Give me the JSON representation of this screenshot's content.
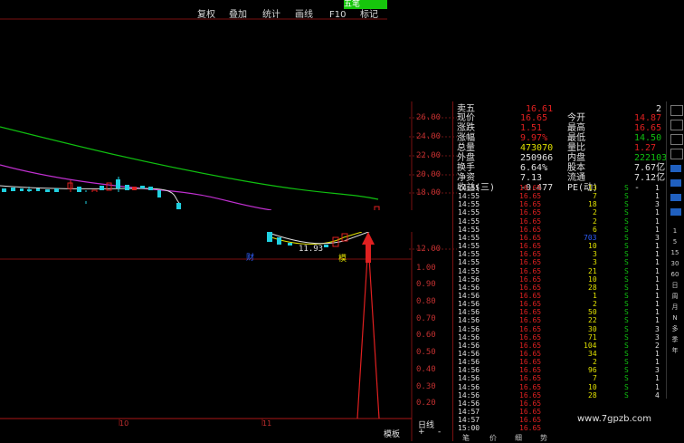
{
  "toolbar": {
    "btn1": "复权",
    "btn2": "叠加",
    "btn3": "统计",
    "btn4": "画线",
    "btn5": "F10",
    "btn6": "标记",
    "tag": "五笔"
  },
  "price_axis": [
    "26.00",
    "24.00",
    "22.00",
    "20.00",
    "18.00",
    "12.00"
  ],
  "vol_axis": [
    "1.00",
    "0.90",
    "0.80",
    "0.70",
    "0.60",
    "0.50",
    "0.40",
    "0.30",
    "0.20"
  ],
  "chart_labels": {
    "low_price": "11.93",
    "cai": "财",
    "mo": "模"
  },
  "bottom": {
    "mode": "模板",
    "period": "日线",
    "plus": "+",
    "minus": "-",
    "tabs": [
      "笔",
      "价",
      "细",
      "势"
    ],
    "date_labels": [
      "10",
      "11"
    ]
  },
  "quote": {
    "sell5_label": "卖五",
    "sell5_val": "16.61",
    "sell5_vol": "2",
    "rows": [
      {
        "l": "现价",
        "v": "16.65",
        "l2": "今开",
        "v2": "14.87"
      },
      {
        "l": "涨跌",
        "v": "1.51",
        "l2": "最高",
        "v2": "16.65"
      },
      {
        "l": "涨幅",
        "v": "9.97%",
        "l2": "最低",
        "v2": "14.50"
      },
      {
        "l": "总量",
        "v": "473070",
        "l2": "量比",
        "v2": "1.27"
      },
      {
        "l": "外盘",
        "v": "250966",
        "l2": "内盘",
        "v2": "222103"
      },
      {
        "l": "换手",
        "v": "6.64%",
        "l2": "股本",
        "v2": "7.67亿"
      },
      {
        "l": "净资",
        "v": "7.13",
        "l2": "流通",
        "v2": "7.12亿"
      },
      {
        "l": "收益(三)",
        "v": "-0.477",
        "l2": "PE(动)",
        "v2": "-"
      }
    ]
  },
  "trades": [
    [
      "14:55",
      "16.65",
      "13",
      "S",
      "1"
    ],
    [
      "14:55",
      "16.65",
      "7",
      "S",
      "1"
    ],
    [
      "14:55",
      "16.65",
      "18",
      "S",
      "3"
    ],
    [
      "14:55",
      "16.65",
      "2",
      "S",
      "1"
    ],
    [
      "14:55",
      "16.65",
      "2",
      "S",
      "1"
    ],
    [
      "14:55",
      "16.65",
      "6",
      "S",
      "1"
    ],
    [
      "14:55",
      "16.65",
      "703",
      "S",
      "3"
    ],
    [
      "14:55",
      "16.65",
      "10",
      "S",
      "1"
    ],
    [
      "14:55",
      "16.65",
      "3",
      "S",
      "1"
    ],
    [
      "14:55",
      "16.65",
      "3",
      "S",
      "1"
    ],
    [
      "14:55",
      "16.65",
      "21",
      "S",
      "1"
    ],
    [
      "14:56",
      "16.65",
      "10",
      "S",
      "1"
    ],
    [
      "14:56",
      "16.65",
      "28",
      "S",
      "1"
    ],
    [
      "14:56",
      "16.65",
      "1",
      "S",
      "1"
    ],
    [
      "14:56",
      "16.65",
      "2",
      "S",
      "1"
    ],
    [
      "14:56",
      "16.65",
      "50",
      "S",
      "1"
    ],
    [
      "14:56",
      "16.65",
      "22",
      "S",
      "1"
    ],
    [
      "14:56",
      "16.65",
      "30",
      "S",
      "3"
    ],
    [
      "14:56",
      "16.65",
      "71",
      "S",
      "3"
    ],
    [
      "14:56",
      "16.65",
      "104",
      "S",
      "2"
    ],
    [
      "14:56",
      "16.65",
      "34",
      "S",
      "1"
    ],
    [
      "14:56",
      "16.65",
      "2",
      "S",
      "1"
    ],
    [
      "14:56",
      "16.65",
      "96",
      "S",
      "3"
    ],
    [
      "14:56",
      "16.65",
      "7",
      "S",
      "1"
    ],
    [
      "14:56",
      "16.65",
      "10",
      "S",
      "1"
    ],
    [
      "14:56",
      "16.65",
      "28",
      "S",
      "4"
    ],
    [
      "14:56",
      "16.65",
      "19",
      "S",
      "2"
    ],
    [
      "14:57",
      "16.65",
      "266",
      "S",
      "8"
    ],
    [
      "14:57",
      "16.65",
      "",
      "",
      ""
    ],
    [
      "15:00",
      "16.65",
      "",
      "",
      ""
    ]
  ],
  "side_buttons": [
    "日",
    "周",
    "月",
    "N",
    "多",
    "季",
    "年",
    "1",
    "5",
    "15",
    "30",
    "60"
  ],
  "watermark": "www.7gpzb.com",
  "colors": {
    "red": "#e02020",
    "green": "#10c010",
    "yellow": "#e0e000",
    "cyan": "#20d0e0",
    "magenta": "#c030d0",
    "axis": "#c03030",
    "white": "#e0e0e0"
  }
}
